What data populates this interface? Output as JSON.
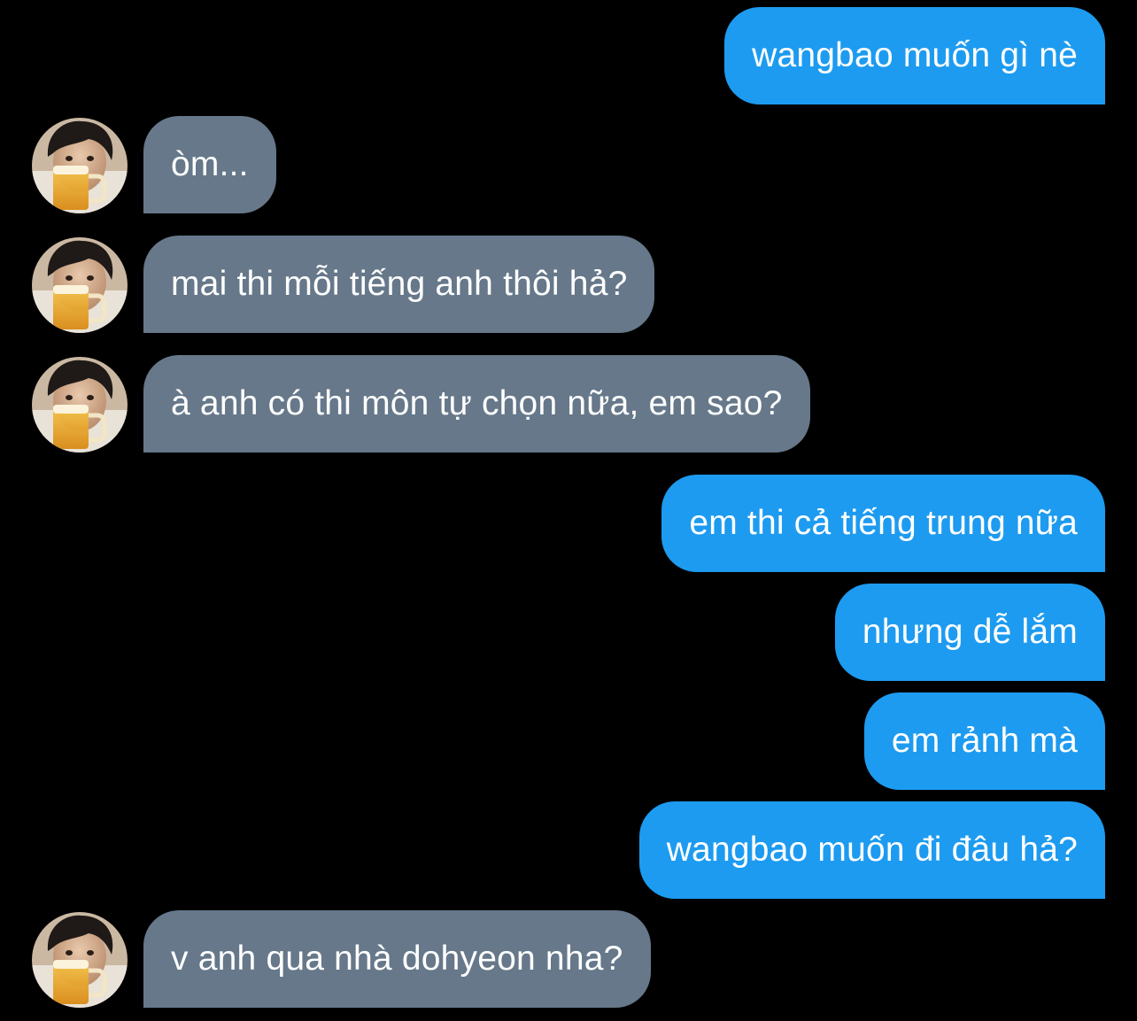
{
  "conversation": {
    "colors": {
      "background": "#000000",
      "outgoing_bubble": "#1d9bf0",
      "incoming_bubble": "#66788a",
      "text": "#ffffff"
    },
    "contact_avatar_icon": "person-with-beer-mug-avatar",
    "messages": [
      {
        "direction": "outgoing",
        "text": "wangbao muốn gì nè"
      },
      {
        "direction": "incoming",
        "text": "òm..."
      },
      {
        "direction": "incoming",
        "text": "mai thi mỗi tiếng anh thôi hả?"
      },
      {
        "direction": "incoming",
        "text": "à anh có thi môn tự chọn nữa, em sao?"
      },
      {
        "direction": "outgoing",
        "text": "em thi cả tiếng trung nữa"
      },
      {
        "direction": "outgoing",
        "text": "nhưng dễ lắm"
      },
      {
        "direction": "outgoing",
        "text": "em rảnh mà"
      },
      {
        "direction": "outgoing",
        "text": "wangbao muốn đi đâu hả?"
      },
      {
        "direction": "incoming",
        "text": "v anh qua nhà dohyeon nha?"
      }
    ]
  }
}
